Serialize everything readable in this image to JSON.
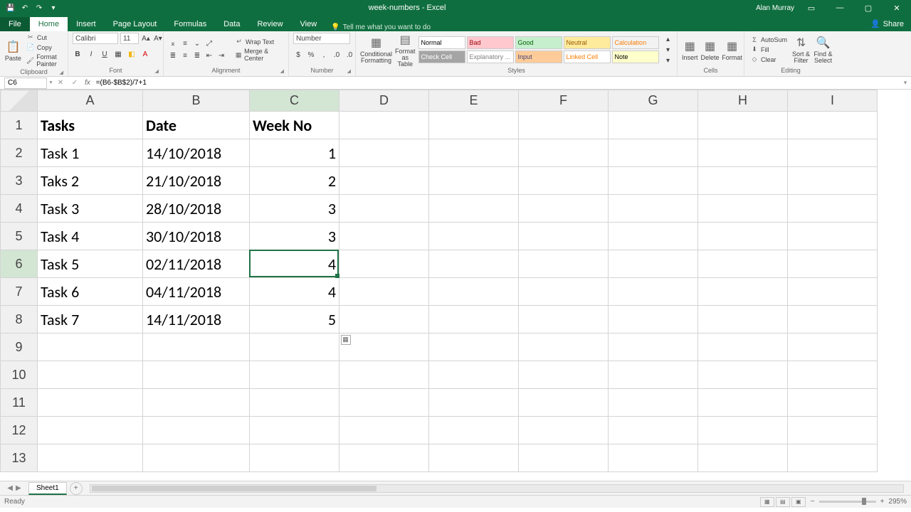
{
  "title": "week-numbers - Excel",
  "user": "Alan Murray",
  "tabs": [
    "File",
    "Home",
    "Insert",
    "Page Layout",
    "Formulas",
    "Data",
    "Review",
    "View"
  ],
  "active_tab": "Home",
  "tell_me": "Tell me what you want to do",
  "share": "Share",
  "clipboard": {
    "cut": "Cut",
    "copy": "Copy",
    "painter": "Format Painter",
    "paste": "Paste",
    "label": "Clipboard"
  },
  "font": {
    "name": "Calibri",
    "size": "11",
    "label": "Font"
  },
  "alignment": {
    "wrap": "Wrap Text",
    "merge": "Merge & Center",
    "label": "Alignment"
  },
  "number": {
    "format": "Number",
    "label": "Number"
  },
  "conditional": "Conditional Formatting",
  "formatas": "Format as Table",
  "styles": {
    "label": "Styles",
    "items": [
      {
        "t": "Normal",
        "bg": "#ffffff",
        "c": "#000"
      },
      {
        "t": "Bad",
        "bg": "#ffc7ce",
        "c": "#9c0006"
      },
      {
        "t": "Good",
        "bg": "#c6efce",
        "c": "#006100"
      },
      {
        "t": "Neutral",
        "bg": "#ffeb9c",
        "c": "#9c5700"
      },
      {
        "t": "Calculation",
        "bg": "#f2f2f2",
        "c": "#fa7d00"
      },
      {
        "t": "Check Cell",
        "bg": "#a5a5a5",
        "c": "#ffffff"
      },
      {
        "t": "Explanatory ...",
        "bg": "#ffffff",
        "c": "#7f7f7f"
      },
      {
        "t": "Input",
        "bg": "#ffcc99",
        "c": "#3f3f76"
      },
      {
        "t": "Linked Cell",
        "bg": "#ffffff",
        "c": "#fa7d00"
      },
      {
        "t": "Note",
        "bg": "#ffffcc",
        "c": "#000"
      }
    ]
  },
  "cells": {
    "insert": "Insert",
    "delete": "Delete",
    "format": "Format",
    "label": "Cells"
  },
  "editing": {
    "autosum": "AutoSum",
    "fill": "Fill",
    "clear": "Clear",
    "sort": "Sort & Filter",
    "find": "Find & Select",
    "label": "Editing"
  },
  "namebox": "C6",
  "formula": "=(B6-$B$2)/7+1",
  "columns": [
    "A",
    "B",
    "C",
    "D",
    "E",
    "F",
    "G",
    "H",
    "I"
  ],
  "rows": [
    1,
    2,
    3,
    4,
    5,
    6,
    7,
    8,
    9,
    10,
    11,
    12,
    13
  ],
  "selected_col_idx": 2,
  "selected_row_idx": 5,
  "chart_data": {
    "type": "table",
    "headers": [
      "Tasks",
      "Date",
      "Week No"
    ],
    "rows": [
      [
        "Task 1",
        "14/10/2018",
        1
      ],
      [
        "Taks 2",
        "21/10/2018",
        2
      ],
      [
        "Task 3",
        "28/10/2018",
        3
      ],
      [
        "Task 4",
        "30/10/2018",
        3
      ],
      [
        "Task 5",
        "02/11/2018",
        4
      ],
      [
        "Task 6",
        "04/11/2018",
        4
      ],
      [
        "Task 7",
        "14/11/2018",
        5
      ]
    ]
  },
  "sheet": "Sheet1",
  "status": "Ready",
  "zoom": "295%"
}
